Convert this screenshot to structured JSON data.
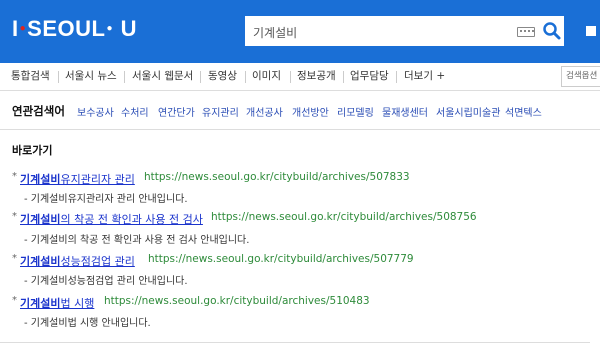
{
  "header": {
    "logo_left": "I",
    "logo_dot": "●",
    "logo_main": "SEOUL",
    "logo_dot2": "●",
    "logo_right": "U",
    "search_value": "기계설비",
    "search_placeholder": "",
    "brand_color": "#1a6fd6"
  },
  "gnb": {
    "items": [
      "통합검색",
      "서울시 뉴스",
      "서울시 웹문서",
      "동영상",
      "이미지",
      "정보공개",
      "업무담당",
      "더보기 +"
    ],
    "search_option": "검색옵션"
  },
  "related": {
    "title": "연관검색어",
    "links": [
      "보수공사",
      "수처리",
      "연간단가",
      "유지관리",
      "개선공사",
      "개선방안",
      "리모델링",
      "물재생센터",
      "서울시립미술관",
      "석면텍스"
    ]
  },
  "goto": {
    "title": "바로가기"
  },
  "results": [
    {
      "bullet": "*",
      "title_bold": "기계설비",
      "title_rest": "유지관리자 관리",
      "url": "https://news.seoul.go.kr/citybuild/archives/507833",
      "desc": "- 기계설비유지관리자 관리 안내입니다."
    },
    {
      "bullet": "*",
      "title_bold": "기계설비",
      "title_rest": "의 착공 전 확인과 사용 전 검사",
      "url": "https://news.seoul.go.kr/citybuild/archives/508756",
      "desc": "- 기계설비의 착공 전 확인과 사용 전 검사 안내입니다."
    },
    {
      "bullet": "*",
      "title_bold": "기계설비",
      "title_rest": "성능점검업 관리",
      "url": "https://news.seoul.go.kr/citybuild/archives/507779",
      "desc": "- 기계설비성능점검업 관리 안내입니다."
    },
    {
      "bullet": "*",
      "title_bold": "기계설비",
      "title_rest": "법 시행",
      "url": "https://news.seoul.go.kr/citybuild/archives/510483",
      "desc": "- 기계설비법 시행 안내입니다."
    }
  ]
}
